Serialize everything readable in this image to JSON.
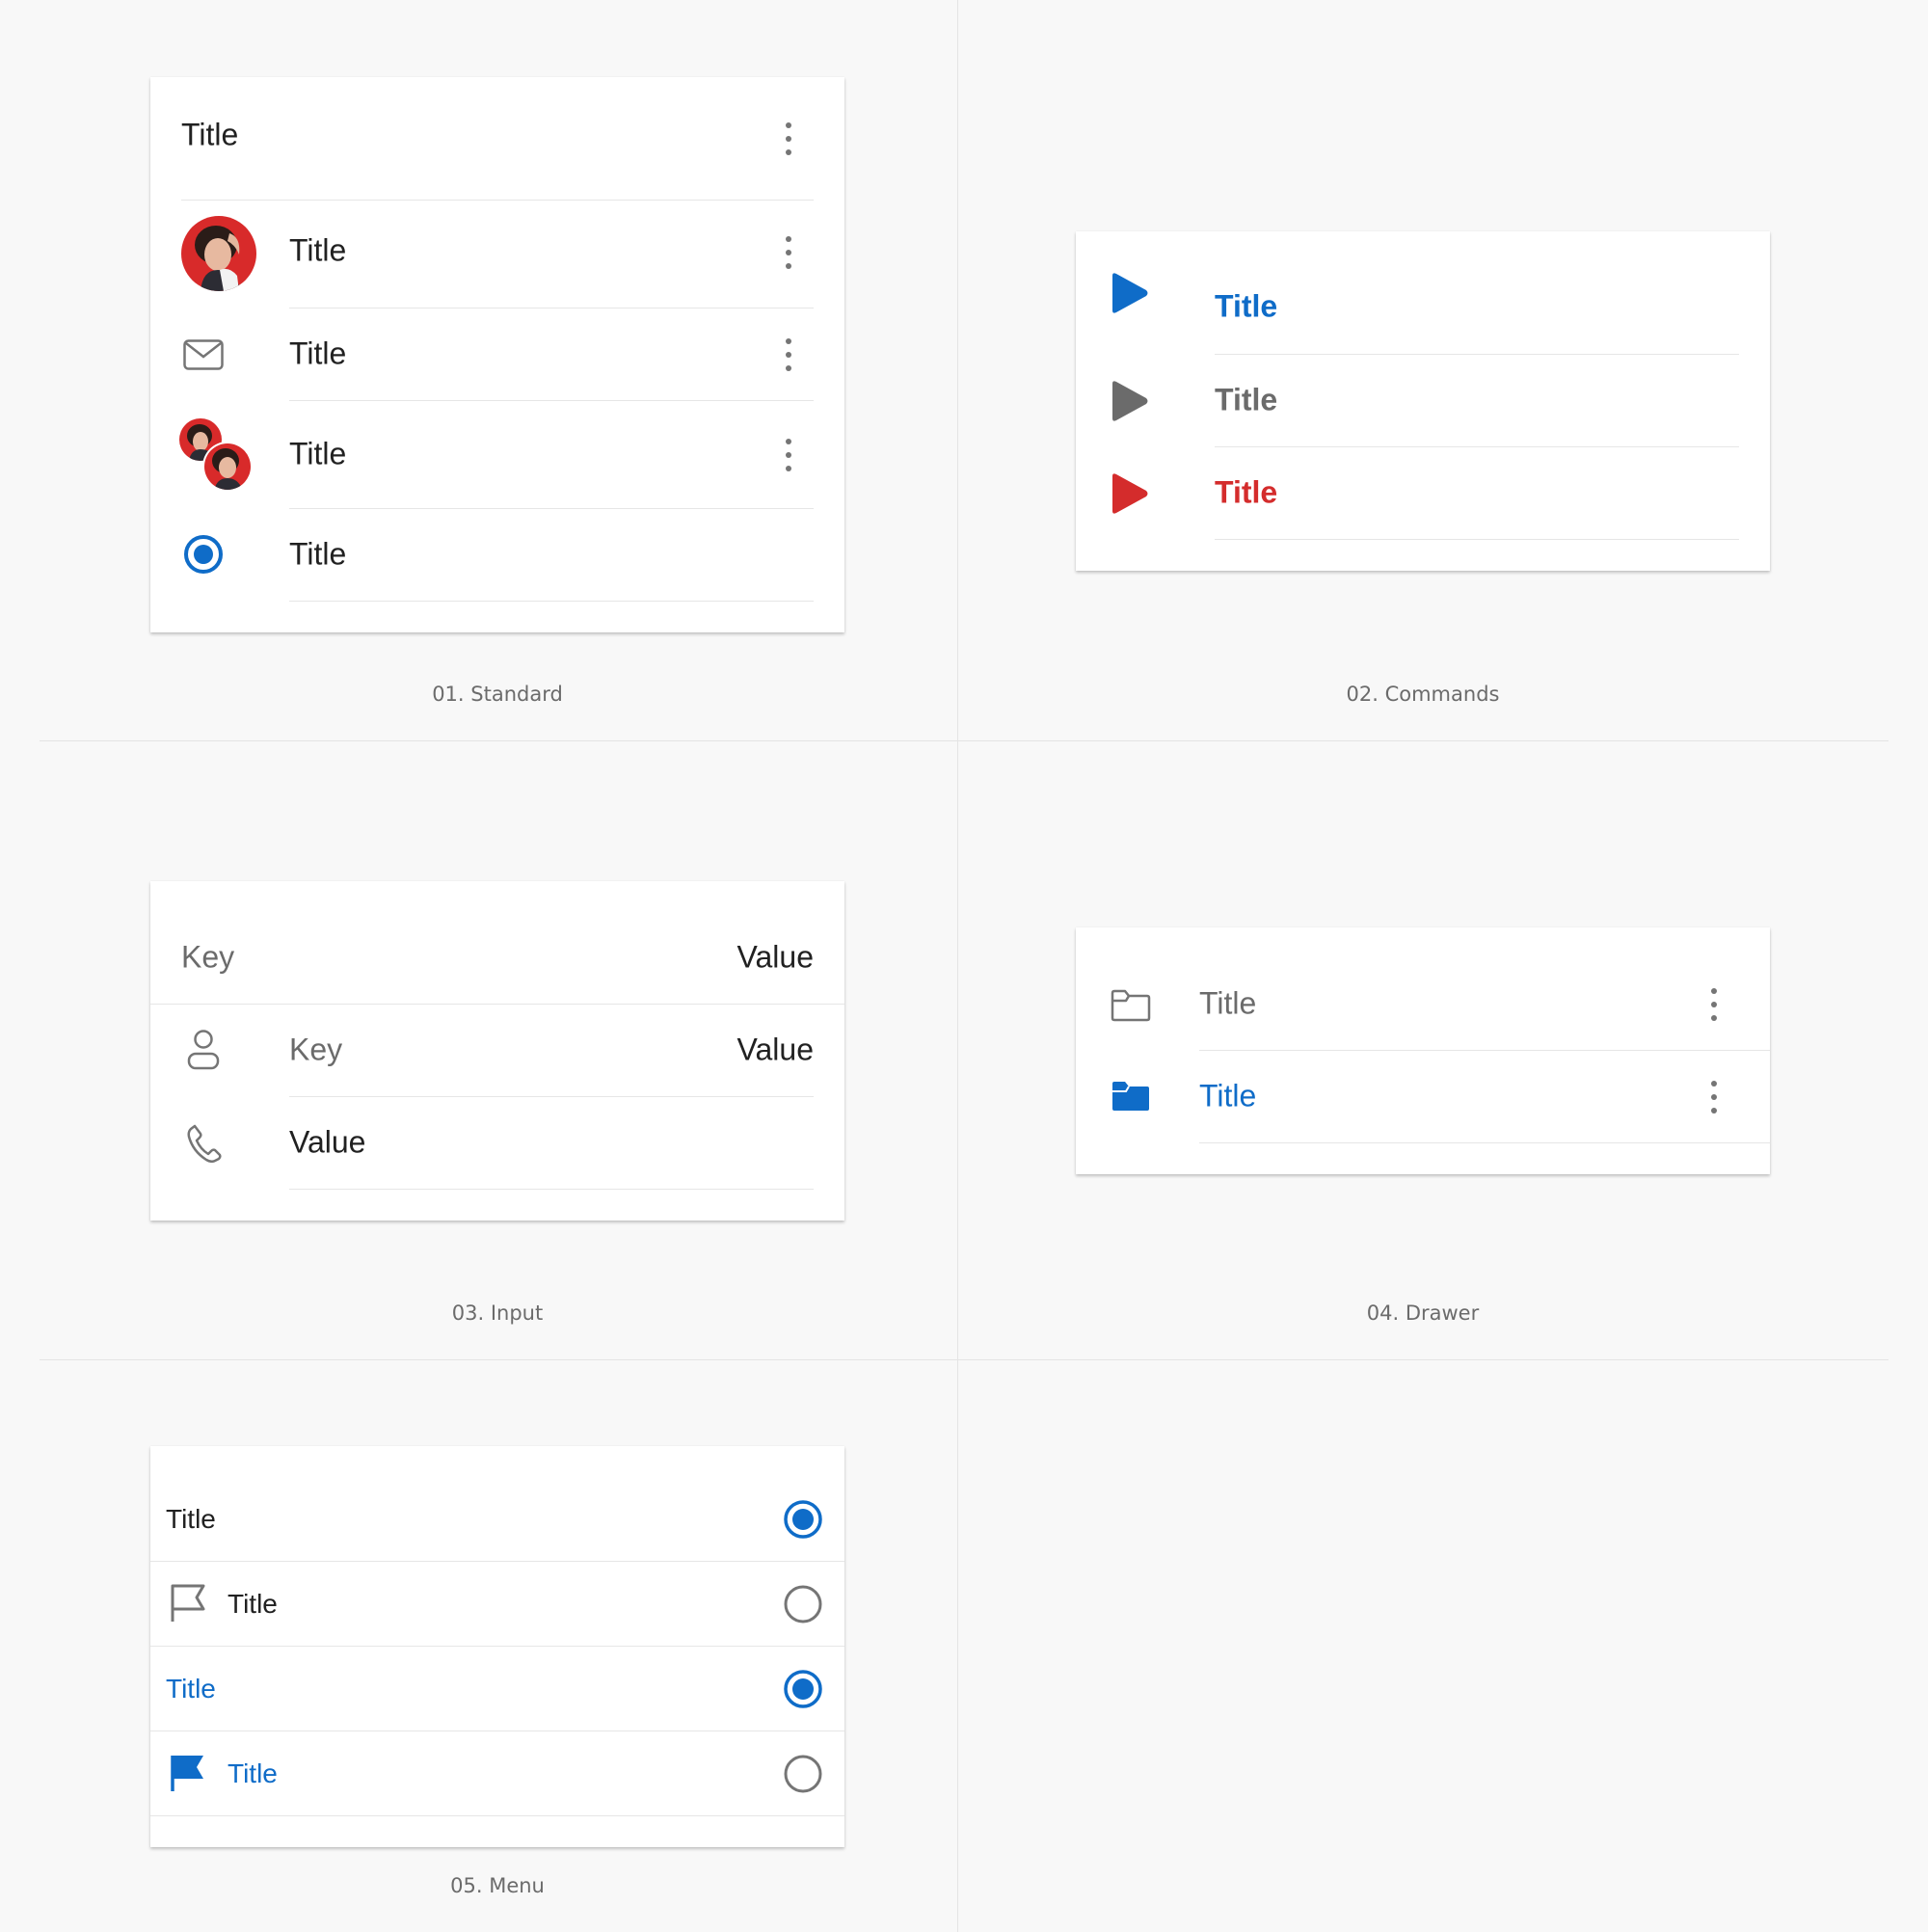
{
  "colors": {
    "accent": "#0f6cc8",
    "danger": "#d42c2c",
    "neutral": "#6b6b6b",
    "text": "#212121",
    "divider": "#e6e6e6",
    "background": "#f8f8f8"
  },
  "standard": {
    "caption": "01. Standard",
    "header_title": "Title",
    "rows": [
      {
        "title": "Title",
        "leading": "avatar-photo",
        "trailing": "more-vertical-icon"
      },
      {
        "title": "Title",
        "leading": "mail-icon",
        "trailing": "more-vertical-icon"
      },
      {
        "title": "Title",
        "leading": "group-avatar",
        "trailing": "more-vertical-icon"
      },
      {
        "title": "Title",
        "leading": "radio-selected-icon",
        "trailing": ""
      }
    ]
  },
  "commands": {
    "caption": "02. Commands",
    "rows": [
      {
        "title": "Title",
        "color": "#0f6cc8",
        "icon": "play-icon"
      },
      {
        "title": "Title",
        "color": "#6b6b6b",
        "icon": "play-icon"
      },
      {
        "title": "Title",
        "color": "#d42c2c",
        "icon": "play-icon"
      }
    ]
  },
  "input": {
    "caption": "03. Input",
    "header": {
      "key": "Key",
      "value": "Value"
    },
    "rows": [
      {
        "icon": "person-icon",
        "key": "Key",
        "value": "Value"
      },
      {
        "icon": "phone-icon",
        "key": "",
        "value": "Value"
      }
    ]
  },
  "drawer": {
    "caption": "04. Drawer",
    "rows": [
      {
        "title": "Title",
        "icon": "folder-outline-icon",
        "state": "default"
      },
      {
        "title": "Title",
        "icon": "folder-filled-icon",
        "state": "selected"
      }
    ]
  },
  "menu": {
    "caption": "05. Menu",
    "rows": [
      {
        "title": "Title",
        "icon": "",
        "selected": true,
        "highlighted": false
      },
      {
        "title": "Title",
        "icon": "flag-outline-icon",
        "selected": false,
        "highlighted": false
      },
      {
        "title": "Title",
        "icon": "",
        "selected": true,
        "highlighted": true
      },
      {
        "title": "Title",
        "icon": "flag-filled-icon",
        "selected": false,
        "highlighted": true
      }
    ]
  }
}
